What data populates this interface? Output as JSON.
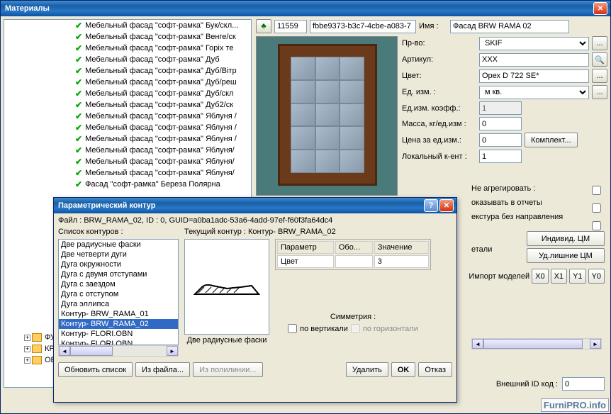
{
  "main": {
    "title": "Материалы",
    "tree_items": [
      "Мебельный фасад \"софт-рамка\" Бук/скл...",
      "Мебельный фасад \"софт-рамка\" Венге/ск",
      "Мебельный фасад \"софт-рамка\" Горіх те",
      "Мебельный фасад \"софт-рамка\" Дуб",
      "Мебельный фасад \"софт-рамка\" Дуб/Вітр",
      "Мебельный фасад \"софт-рамка\" Дуб/реш",
      "Мебельный фасад \"софт-рамка\" Дуб/скл",
      "Мебельный фасад \"софт-рамка\" Дуб2/ск",
      "Мебельный фасад \"софт-рамка\" Яблуня /",
      "Мебельный фасад \"софт-рамка\" Яблуня /",
      "Мебельный фасад \"софт-рамка\" Яблуня /",
      "Мебельный фасад \"софт-рамка\" Яблуня/",
      "Мебельный фасад \"софт-рамка\" Яблуня/",
      "Мебельный фасад \"софт-рамка\" Яблуня/",
      "Фасад \"софт-рамка\" Береза Полярна"
    ],
    "tree_bottom": [
      "ФУР",
      "КРО",
      "ОБЪ"
    ]
  },
  "props": {
    "id": "11559",
    "guid": "fbbe9373-b3c7-4cbe-a083-7",
    "name_lbl": "Имя :",
    "name": "Фасад BRW RAMA 02",
    "mfr_lbl": "Пр-во:",
    "mfr": "SKIF",
    "art_lbl": "Артикул:",
    "art": "XXX",
    "color_lbl": "Цвет:",
    "color": "Орех D 722 SE*",
    "unit_lbl": "Ед. изм. :",
    "unit": "м кв.",
    "coef_lbl": "Ед.изм. коэфф.:",
    "coef": "1",
    "mass_lbl": "Масса, кг/ед.изм :",
    "mass": "0",
    "price_lbl": "Цена за ед.изм.:",
    "price": "0",
    "complect": "Комплект...",
    "local_lbl": "Локальный к-ент :",
    "local": "1",
    "noagg": "Не агрегировать :",
    "noshow": "оказывать в отчеты",
    "nodir": "екстура без направления"
  },
  "side": {
    "indiv": "Индивид. ЦМ",
    "remove": "Уд.лишние ЦМ",
    "detail": "етали",
    "import": "Импорт моделей",
    "x0": "X0",
    "x1": "X1",
    "y1": "Y1",
    "y0": "Y0",
    "ext_id": "Внешний ID код :",
    "ext_val": "0"
  },
  "dlg": {
    "title": "Параметрический контур",
    "file": "Файл : BRW_RAMA_02, ID : 0, GUID=a0ba1adc-53a6-4add-97ef-f60f3fa64dc4",
    "list_lbl": "Список контуров :",
    "current_lbl": "Текущий контур : Контур- BRW_RAMA_02",
    "items": [
      "Две радиусные фаски",
      "Две четверти дуги",
      "Дуга окружности",
      "Дуга с двумя отступами",
      "Дуга с заездом",
      "Дуга с отступом",
      "Дуга эллипса",
      "Контур- BRW_RAMA_01",
      "Контур- BRW_RAMA_02",
      "Контур- FLORI.OBN",
      "Контур- FLORI.OBN"
    ],
    "selected_idx": 8,
    "preview_caption": "Две радиусные фаски",
    "params": {
      "h_param": "Параметр",
      "h_obo": "Обо...",
      "h_val": "Значение",
      "r_param": "Цвет",
      "r_obo": "",
      "r_val": "3"
    },
    "sym": "Симметрия :",
    "vert": "по вертикали",
    "horz": "по горизонтали",
    "refresh": "Обновить список",
    "fromfile": "Из файла...",
    "frompoly": "Из полилинии...",
    "delete": "Удалить",
    "ok": "OK",
    "cancel": "Отказ"
  },
  "watermark": "FurniPRO.info"
}
